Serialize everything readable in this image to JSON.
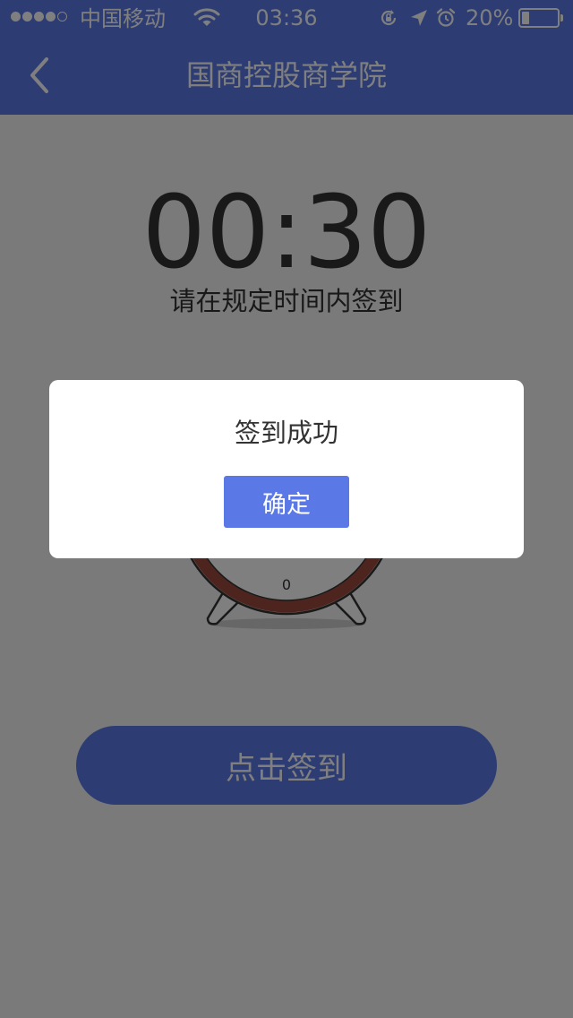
{
  "colors": {
    "accent": "#5a78e6",
    "overlay": "rgba(0,0,0,0.5)",
    "page_background": "#f5f5f5",
    "text": "#333333",
    "clock_ring": "#9b4a3c"
  },
  "status_bar": {
    "carrier": "中国移动",
    "time": "03:36",
    "battery_percent": "20%",
    "battery_level": 0.2,
    "signal_bars_filled": 4,
    "signal_bars_total": 5,
    "icons": [
      "wifi-icon",
      "orientation-lock-icon",
      "location-arrow-icon",
      "alarm-icon",
      "battery-icon"
    ]
  },
  "nav": {
    "title": "国商控股商学院",
    "back_icon": "chevron-left-icon"
  },
  "main": {
    "timer": "00:30",
    "hint": "请在规定时间内签到",
    "illustration_icon": "alarm-clock-icon",
    "clock_center_digit": "0",
    "sign_in_label": "点击签到"
  },
  "dialog": {
    "message": "签到成功",
    "confirm_label": "确定"
  }
}
